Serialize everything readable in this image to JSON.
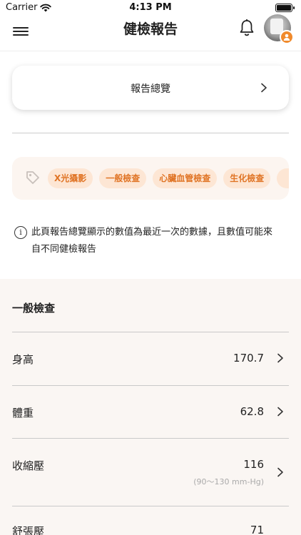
{
  "status_bar": {
    "carrier": "Carrier",
    "time": "4:13 PM"
  },
  "nav": {
    "title": "健檢報告"
  },
  "overview": {
    "label": "報告總覽"
  },
  "tags": [
    "X光攝影",
    "一般檢查",
    "心臟血管檢查",
    "生化檢查"
  ],
  "info_note": {
    "text": "此頁報告總覽顯示的數值為最近一次的數據，且數值可能來自不同健檢報告"
  },
  "section": {
    "title": "一般檢查",
    "rows": [
      {
        "label": "身高",
        "value": "170.7",
        "range": ""
      },
      {
        "label": "體重",
        "value": "62.8",
        "range": ""
      },
      {
        "label": "收縮壓",
        "value": "116",
        "range": "(90～130 mm-Hg)"
      },
      {
        "label": "舒張壓",
        "value": "71",
        "range": ""
      }
    ]
  },
  "colors": {
    "accent": "#f08a2c",
    "chip_bg": "#fde6d4",
    "chip_text": "#e07425",
    "section_bg": "#faf6f3"
  }
}
